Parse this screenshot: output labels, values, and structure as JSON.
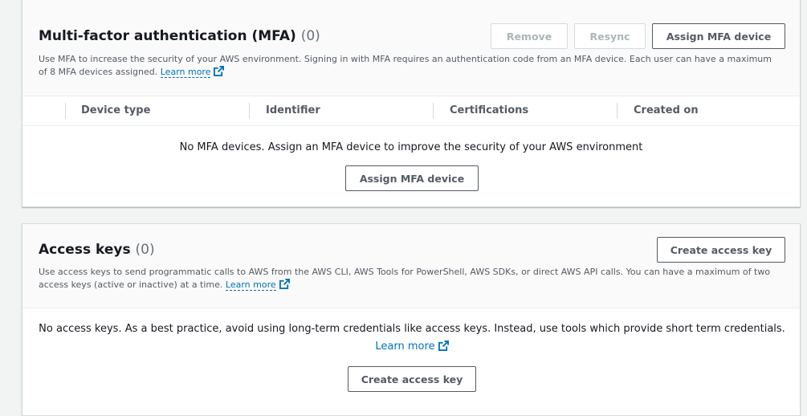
{
  "mfa": {
    "title": "Multi-factor authentication (MFA)",
    "count": "(0)",
    "remove_label": "Remove",
    "resync_label": "Resync",
    "assign_label": "Assign MFA device",
    "description": "Use MFA to increase the security of your AWS environment. Signing in with MFA requires an authentication code from an MFA device. Each user can have a maximum of 8 MFA devices assigned.",
    "learn_more": "Learn more",
    "columns": [
      "Device type",
      "Identifier",
      "Certifications",
      "Created on"
    ],
    "empty_message": "No MFA devices. Assign an MFA device to improve the security of your AWS environment",
    "empty_assign_label": "Assign MFA device"
  },
  "access_keys": {
    "title": "Access keys",
    "count": "(0)",
    "create_label": "Create access key",
    "description": "Use access keys to send programmatic calls to AWS from the AWS CLI, AWS Tools for PowerShell, AWS SDKs, or direct AWS API calls. You can have a maximum of two access keys (active or inactive) at a time.",
    "learn_more": "Learn more",
    "empty_message": "No access keys. As a best practice, avoid using long-term credentials like access keys. Instead, use tools which provide short term credentials.",
    "empty_learn_more": "Learn more",
    "empty_create_label": "Create access key"
  },
  "colors": {
    "link": "#0073bb",
    "background": "#f2f3f3",
    "border": "#d5dbdb"
  },
  "icons": {
    "external_link": "external-link-icon"
  }
}
